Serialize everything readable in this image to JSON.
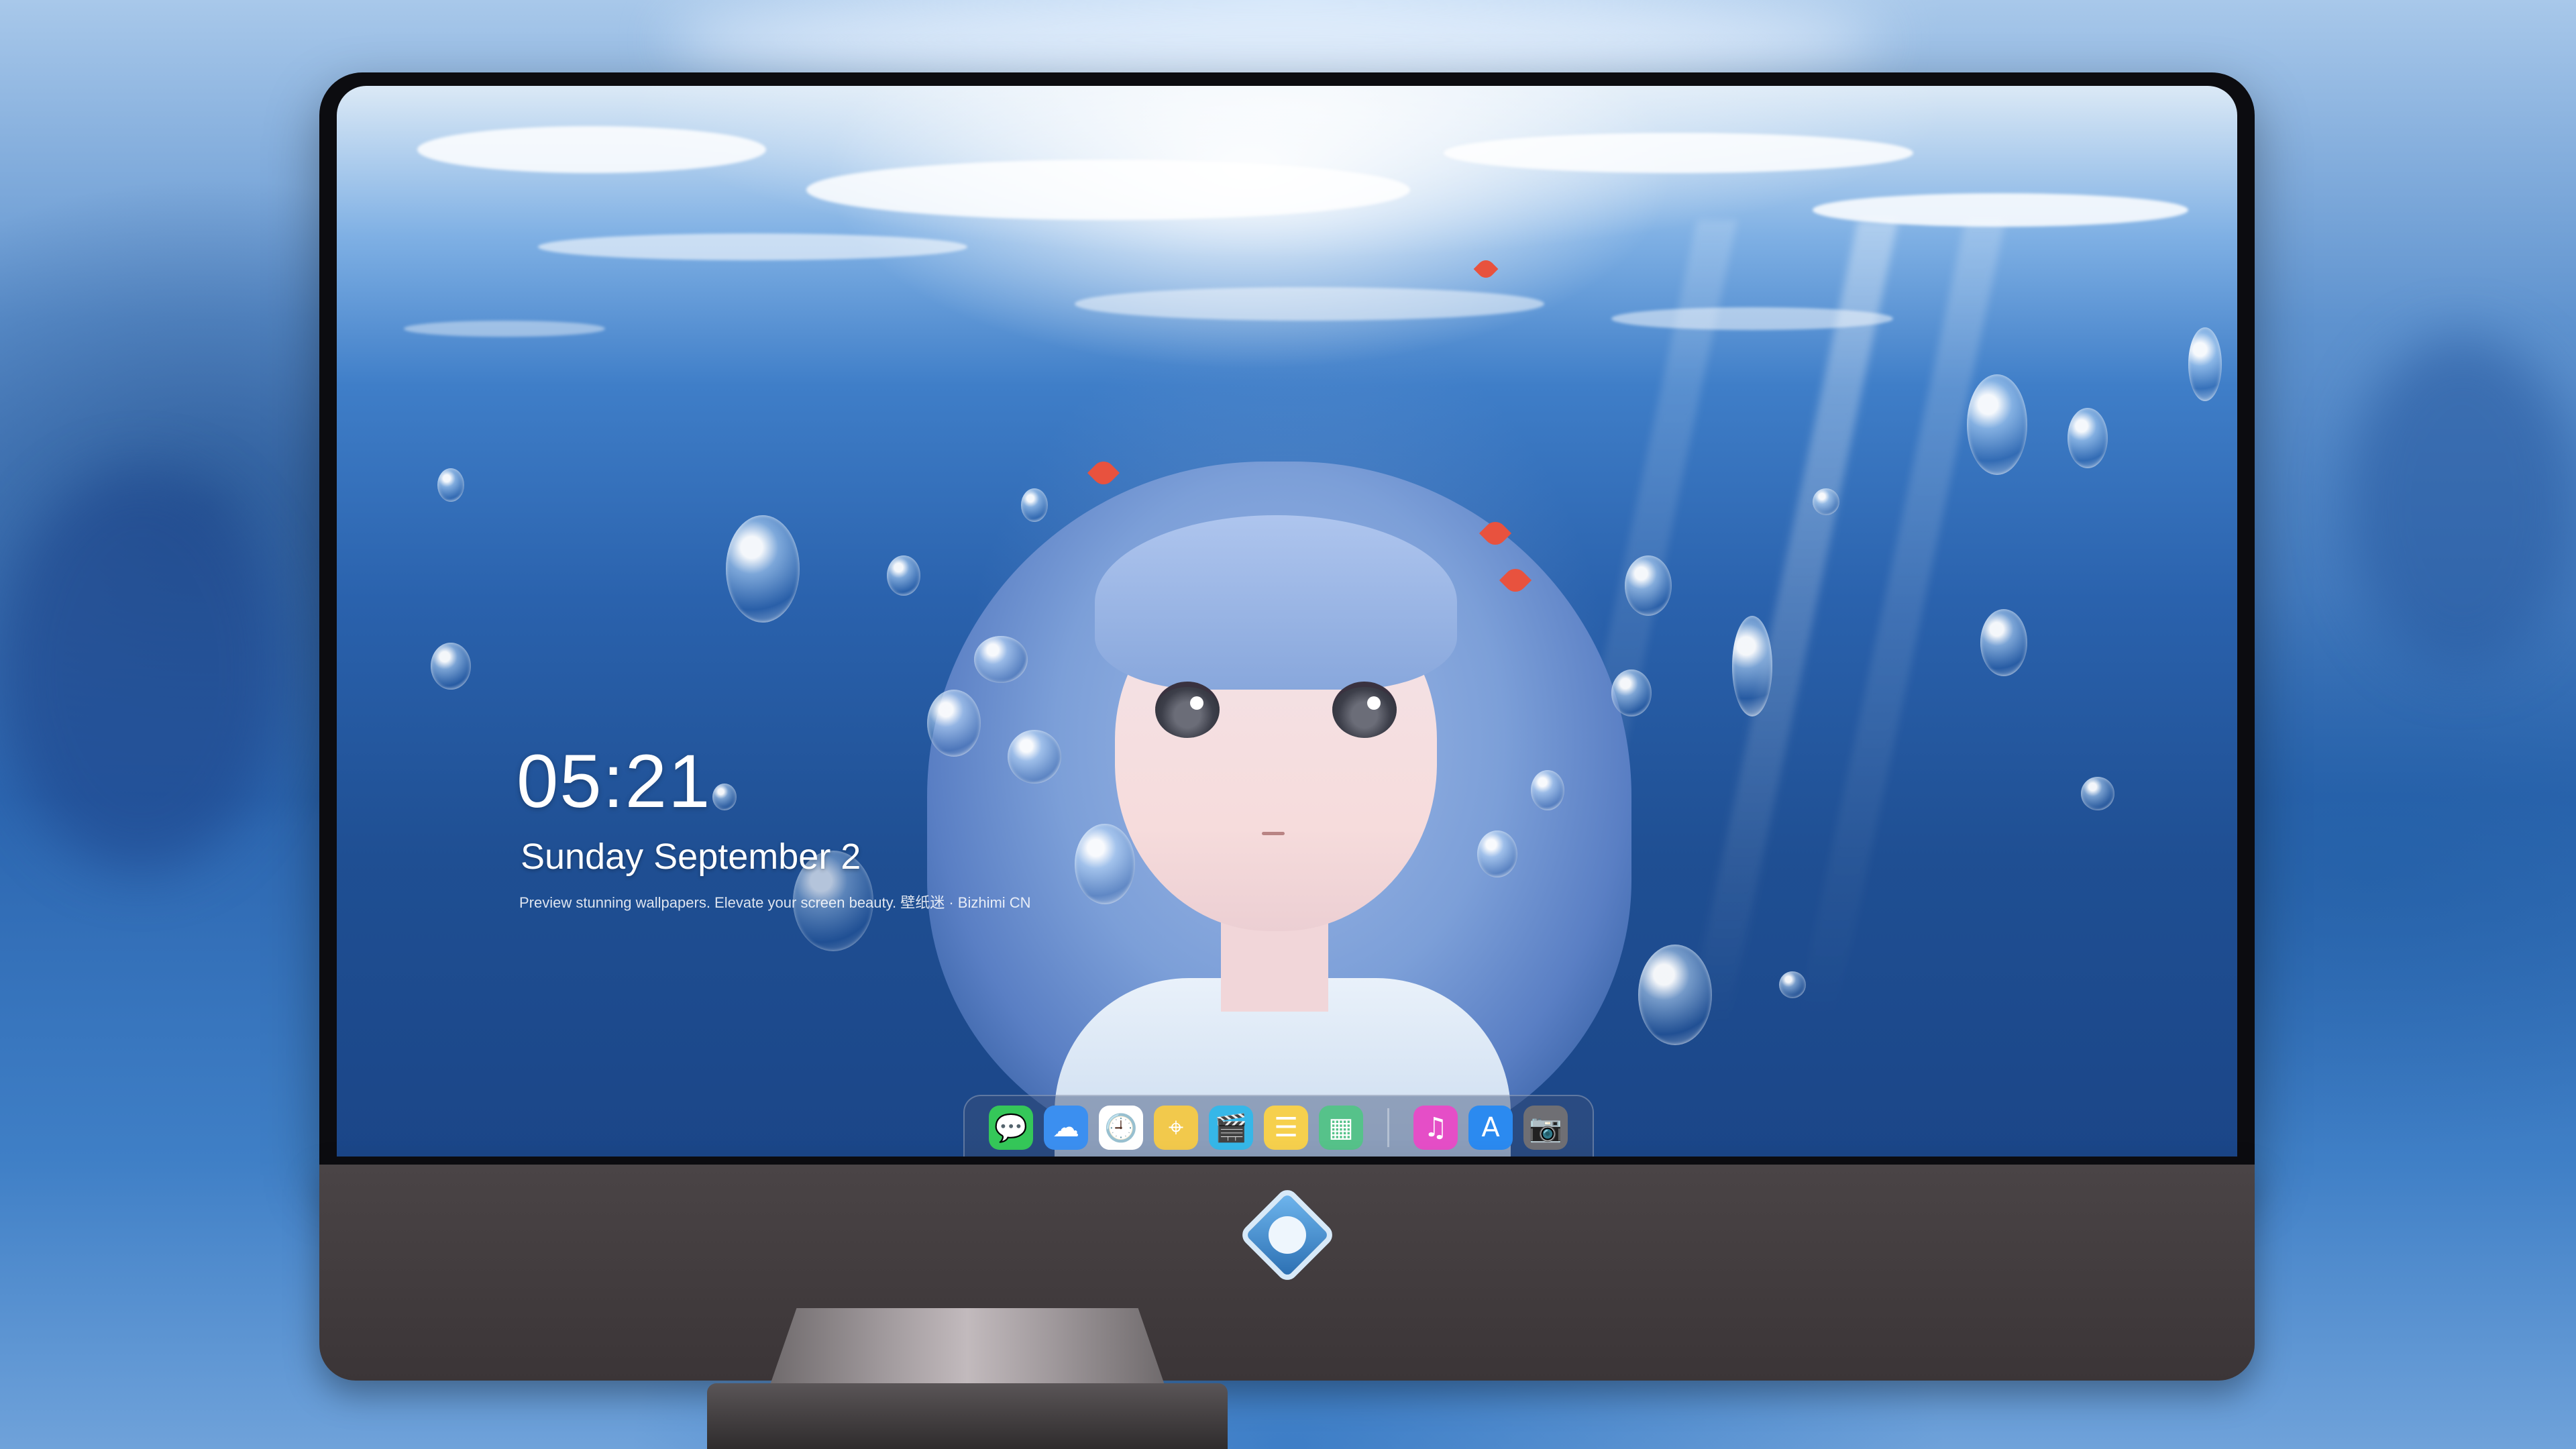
{
  "lock_screen": {
    "time": "05:21",
    "date": "Sunday September  2",
    "caption": "Preview stunning wallpapers. Elevate your screen beauty. 壁纸迷 · Bizhimi CN"
  },
  "dock": {
    "apps": [
      {
        "name": "messages-icon",
        "glyph": "💬",
        "color": "#35c759"
      },
      {
        "name": "weather-icon",
        "glyph": "☁",
        "color": "#3b8ff0"
      },
      {
        "name": "clock-icon",
        "glyph": "🕘",
        "color": "#ffffff"
      },
      {
        "name": "maps-icon",
        "glyph": "⌖",
        "color": "#f2c94c"
      },
      {
        "name": "clips-icon",
        "glyph": "🎬",
        "color": "#36b7e8"
      },
      {
        "name": "notes-icon",
        "glyph": "☰",
        "color": "#f6d04d"
      },
      {
        "name": "photos-icon",
        "glyph": "▦",
        "color": "#56c28a"
      },
      {
        "name": "music-icon",
        "glyph": "♫",
        "color": "#e54ec7"
      },
      {
        "name": "app-store-icon",
        "glyph": "A",
        "color": "#2b8af0"
      },
      {
        "name": "camera-icon",
        "glyph": "📷",
        "color": "#6f6f74"
      }
    ]
  }
}
